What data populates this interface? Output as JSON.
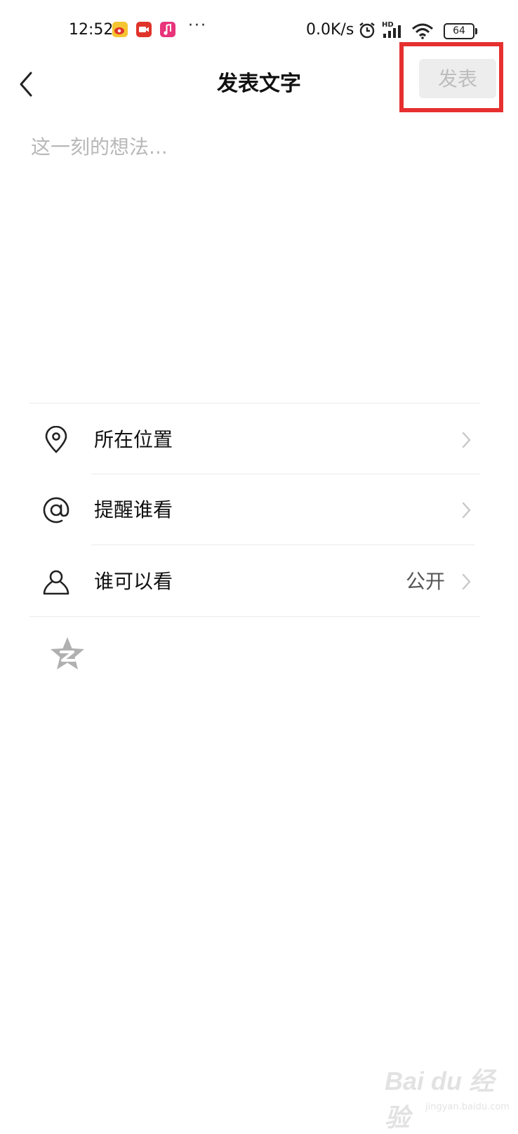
{
  "status_bar": {
    "time": "12:52",
    "dots": "···",
    "net_speed": "0.0K/s",
    "hd_label": "HD",
    "battery": "64"
  },
  "nav": {
    "title": "发表文字",
    "publish_label": "发表",
    "highlight_color": "#e63030"
  },
  "compose": {
    "placeholder": "这一刻的想法...",
    "value": ""
  },
  "options": [
    {
      "icon": "location-pin-icon",
      "label": "所在位置",
      "value": ""
    },
    {
      "icon": "at-sign-icon",
      "label": "提醒谁看",
      "value": ""
    },
    {
      "icon": "person-icon",
      "label": "谁可以看",
      "value": "公开"
    }
  ],
  "watermark": {
    "text": "Bai du 经验",
    "sub": "jingyan.baidu.com"
  },
  "colors": {
    "publish_bg": "#ededed",
    "publish_text": "#bdbdbd",
    "placeholder": "#b8b8b8",
    "qzone_star": "#b0b0b0"
  }
}
